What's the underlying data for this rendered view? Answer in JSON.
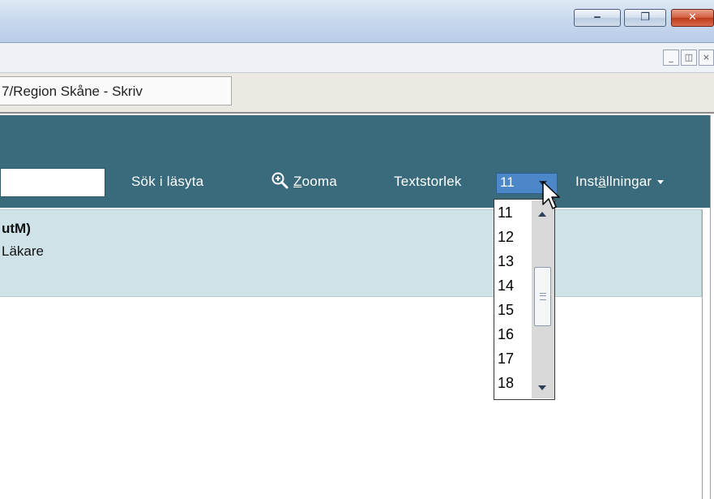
{
  "window": {
    "minimize_glyph": "‒",
    "restore_glyph": "❐",
    "close_glyph": "✕",
    "mdi_minimize_glyph": "_",
    "mdi_restore_glyph": "◫",
    "mdi_close_glyph": "×"
  },
  "tab": {
    "label": "7/Region Skåne - Skriv"
  },
  "toolbar": {
    "search_label": "Sök i läsyta",
    "zoom_icon": "zoom-in-icon",
    "zoom_accel": "Z",
    "zoom_rest": "ooma",
    "textsize_label": "Textstorlek",
    "textsize_value": "11",
    "settings_pre": "Inst",
    "settings_accel": "ä",
    "settings_post": "llningar"
  },
  "patient": {
    "name": "utM)",
    "role": "Läkare"
  },
  "dropdown": {
    "options": [
      "11",
      "12",
      "13",
      "14",
      "15",
      "16",
      "17",
      "18"
    ]
  },
  "colors": {
    "header": "#396b7c",
    "panel": "#cfe2e8",
    "select": "#4c88c9"
  }
}
